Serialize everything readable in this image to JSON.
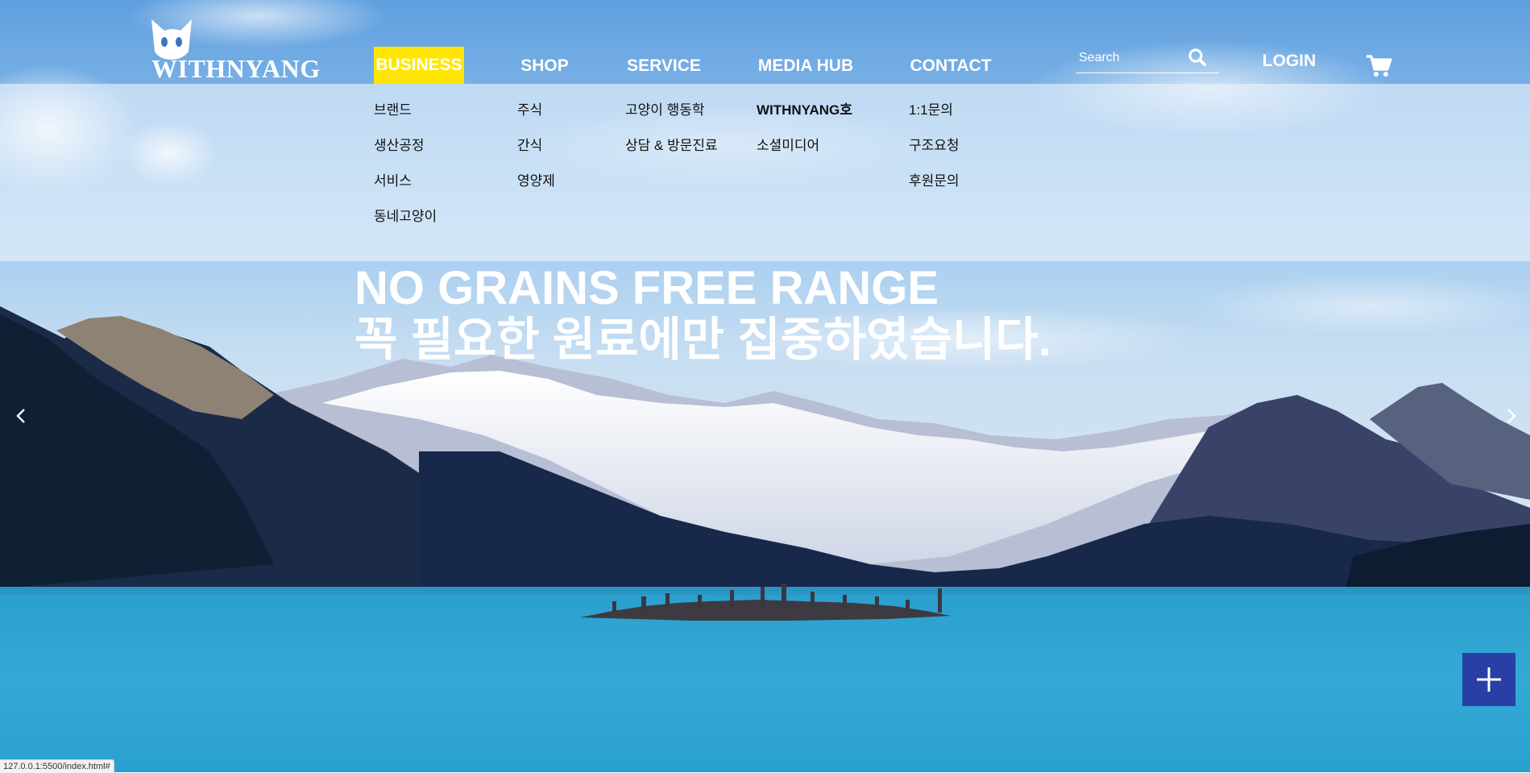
{
  "brand": {
    "logo_text": "WITHNYANG"
  },
  "nav": {
    "business": "BUSINESS",
    "shop": "SHOP",
    "service": "SERVICE",
    "media_hub": "MEDIA HUB",
    "contact": "CONTACT",
    "active": "BUSINESS",
    "active_color": "#ffe600"
  },
  "search": {
    "placeholder": "Search"
  },
  "header_right": {
    "login": "LOGIN"
  },
  "submenu": {
    "business": [
      "브랜드",
      "생산공정",
      "서비스",
      "동네고양이"
    ],
    "shop": [
      "주식",
      "간식",
      "영양제"
    ],
    "service": [
      "고양이 행동학",
      "상담 & 방문진료"
    ],
    "media_hub": [
      "WITHNYANG호",
      "소셜미디어"
    ],
    "contact": [
      "1:1문의",
      "구조요청",
      "후원문의"
    ]
  },
  "hero": {
    "line1": "NO GRAINS FREE RANGE",
    "line2": "꼭 필요한 원료에만 집중하였습니다."
  },
  "icons": {
    "search": "search-icon",
    "cart": "cart-icon",
    "prev": "chevron-left-icon",
    "next": "chevron-right-icon",
    "plus": "plus-icon"
  },
  "colors": {
    "plus_button": "#2a3fa6"
  },
  "status_bar": {
    "url": "127.0.0.1:5500/index.html#"
  }
}
